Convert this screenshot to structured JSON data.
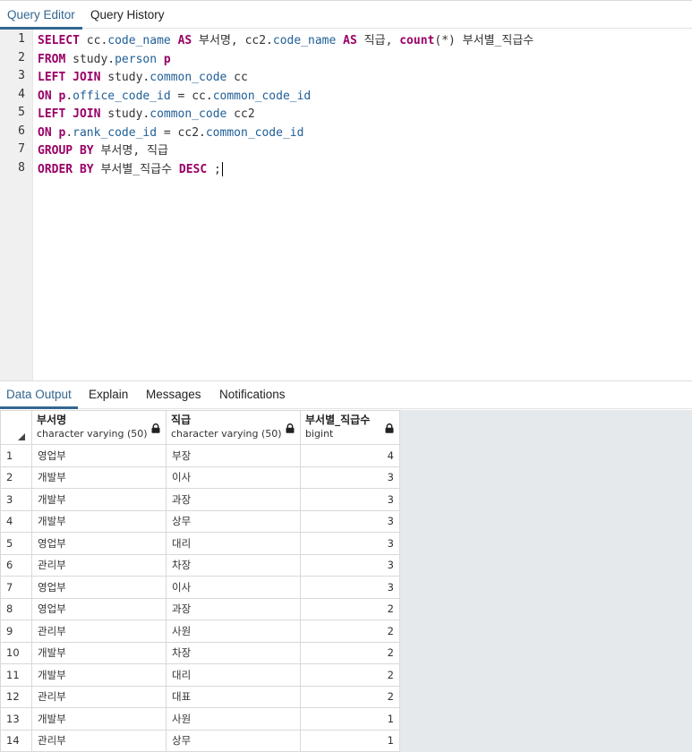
{
  "top_tabs": [
    {
      "label": "Query Editor",
      "active": true
    },
    {
      "label": "Query History",
      "active": false
    }
  ],
  "editor": {
    "line_numbers": [
      "1",
      "2",
      "3",
      "4",
      "5",
      "6",
      "7",
      "8"
    ],
    "lines": [
      [
        {
          "t": "SELECT",
          "c": "kw"
        },
        {
          "t": " cc.",
          "c": ""
        },
        {
          "t": "code_name",
          "c": "id"
        },
        {
          "t": " ",
          "c": ""
        },
        {
          "t": "AS",
          "c": "kw"
        },
        {
          "t": " 부서명, cc2.",
          "c": ""
        },
        {
          "t": "code_name",
          "c": "id"
        },
        {
          "t": " ",
          "c": ""
        },
        {
          "t": "AS",
          "c": "kw"
        },
        {
          "t": " 직급, ",
          "c": ""
        },
        {
          "t": "count",
          "c": "kw"
        },
        {
          "t": "(*) 부서별_직급수",
          "c": ""
        }
      ],
      [
        {
          "t": "FROM",
          "c": "kw"
        },
        {
          "t": " study.",
          "c": ""
        },
        {
          "t": "person",
          "c": "id"
        },
        {
          "t": " ",
          "c": ""
        },
        {
          "t": "p",
          "c": "kw"
        }
      ],
      [
        {
          "t": "LEFT JOIN",
          "c": "kw"
        },
        {
          "t": " study.",
          "c": ""
        },
        {
          "t": "common_code",
          "c": "id"
        },
        {
          "t": " cc",
          "c": ""
        }
      ],
      [
        {
          "t": "ON",
          "c": "kw"
        },
        {
          "t": " ",
          "c": ""
        },
        {
          "t": "p",
          "c": "kw"
        },
        {
          "t": ".",
          "c": ""
        },
        {
          "t": "office_code_id",
          "c": "id"
        },
        {
          "t": " = cc.",
          "c": ""
        },
        {
          "t": "common_code_id",
          "c": "id"
        }
      ],
      [
        {
          "t": "LEFT JOIN",
          "c": "kw"
        },
        {
          "t": " study.",
          "c": ""
        },
        {
          "t": "common_code",
          "c": "id"
        },
        {
          "t": " cc2",
          "c": ""
        }
      ],
      [
        {
          "t": "ON",
          "c": "kw"
        },
        {
          "t": " ",
          "c": ""
        },
        {
          "t": "p",
          "c": "kw"
        },
        {
          "t": ".",
          "c": ""
        },
        {
          "t": "rank_code_id",
          "c": "id"
        },
        {
          "t": " = cc2.",
          "c": ""
        },
        {
          "t": "common_code_id",
          "c": "id"
        }
      ],
      [
        {
          "t": "GROUP BY",
          "c": "kw"
        },
        {
          "t": " 부서명, 직급",
          "c": ""
        }
      ],
      [
        {
          "t": "ORDER BY",
          "c": "kw"
        },
        {
          "t": " 부서별_직급수 ",
          "c": ""
        },
        {
          "t": "DESC",
          "c": "kw"
        },
        {
          "t": " ;",
          "c": ""
        }
      ]
    ]
  },
  "bottom_tabs": [
    {
      "label": "Data Output",
      "active": true
    },
    {
      "label": "Explain",
      "active": false
    },
    {
      "label": "Messages",
      "active": false
    },
    {
      "label": "Notifications",
      "active": false
    }
  ],
  "grid": {
    "columns": [
      {
        "name": "부서명",
        "type": "character varying (50)",
        "icon": "lock-icon"
      },
      {
        "name": "직급",
        "type": "character varying (50)",
        "icon": "lock-icon"
      },
      {
        "name": "부서별_직급수",
        "type": "bigint",
        "icon": "lock-icon"
      }
    ],
    "rows": [
      {
        "n": "1",
        "dept": "영업부",
        "rank": "부장",
        "count": "4"
      },
      {
        "n": "2",
        "dept": "개발부",
        "rank": "이사",
        "count": "3"
      },
      {
        "n": "3",
        "dept": "개발부",
        "rank": "과장",
        "count": "3"
      },
      {
        "n": "4",
        "dept": "개발부",
        "rank": "상무",
        "count": "3"
      },
      {
        "n": "5",
        "dept": "영업부",
        "rank": "대리",
        "count": "3"
      },
      {
        "n": "6",
        "dept": "관리부",
        "rank": "차장",
        "count": "3"
      },
      {
        "n": "7",
        "dept": "영업부",
        "rank": "이사",
        "count": "3"
      },
      {
        "n": "8",
        "dept": "영업부",
        "rank": "과장",
        "count": "2"
      },
      {
        "n": "9",
        "dept": "관리부",
        "rank": "사원",
        "count": "2"
      },
      {
        "n": "10",
        "dept": "개발부",
        "rank": "차장",
        "count": "2"
      },
      {
        "n": "11",
        "dept": "개발부",
        "rank": "대리",
        "count": "2"
      },
      {
        "n": "12",
        "dept": "관리부",
        "rank": "대표",
        "count": "2"
      },
      {
        "n": "13",
        "dept": "개발부",
        "rank": "사원",
        "count": "1"
      },
      {
        "n": "14",
        "dept": "관리부",
        "rank": "상무",
        "count": "1"
      }
    ]
  },
  "colors": {
    "accent": "#326690",
    "keyword": "#990066",
    "identifier": "#1f5e96"
  }
}
